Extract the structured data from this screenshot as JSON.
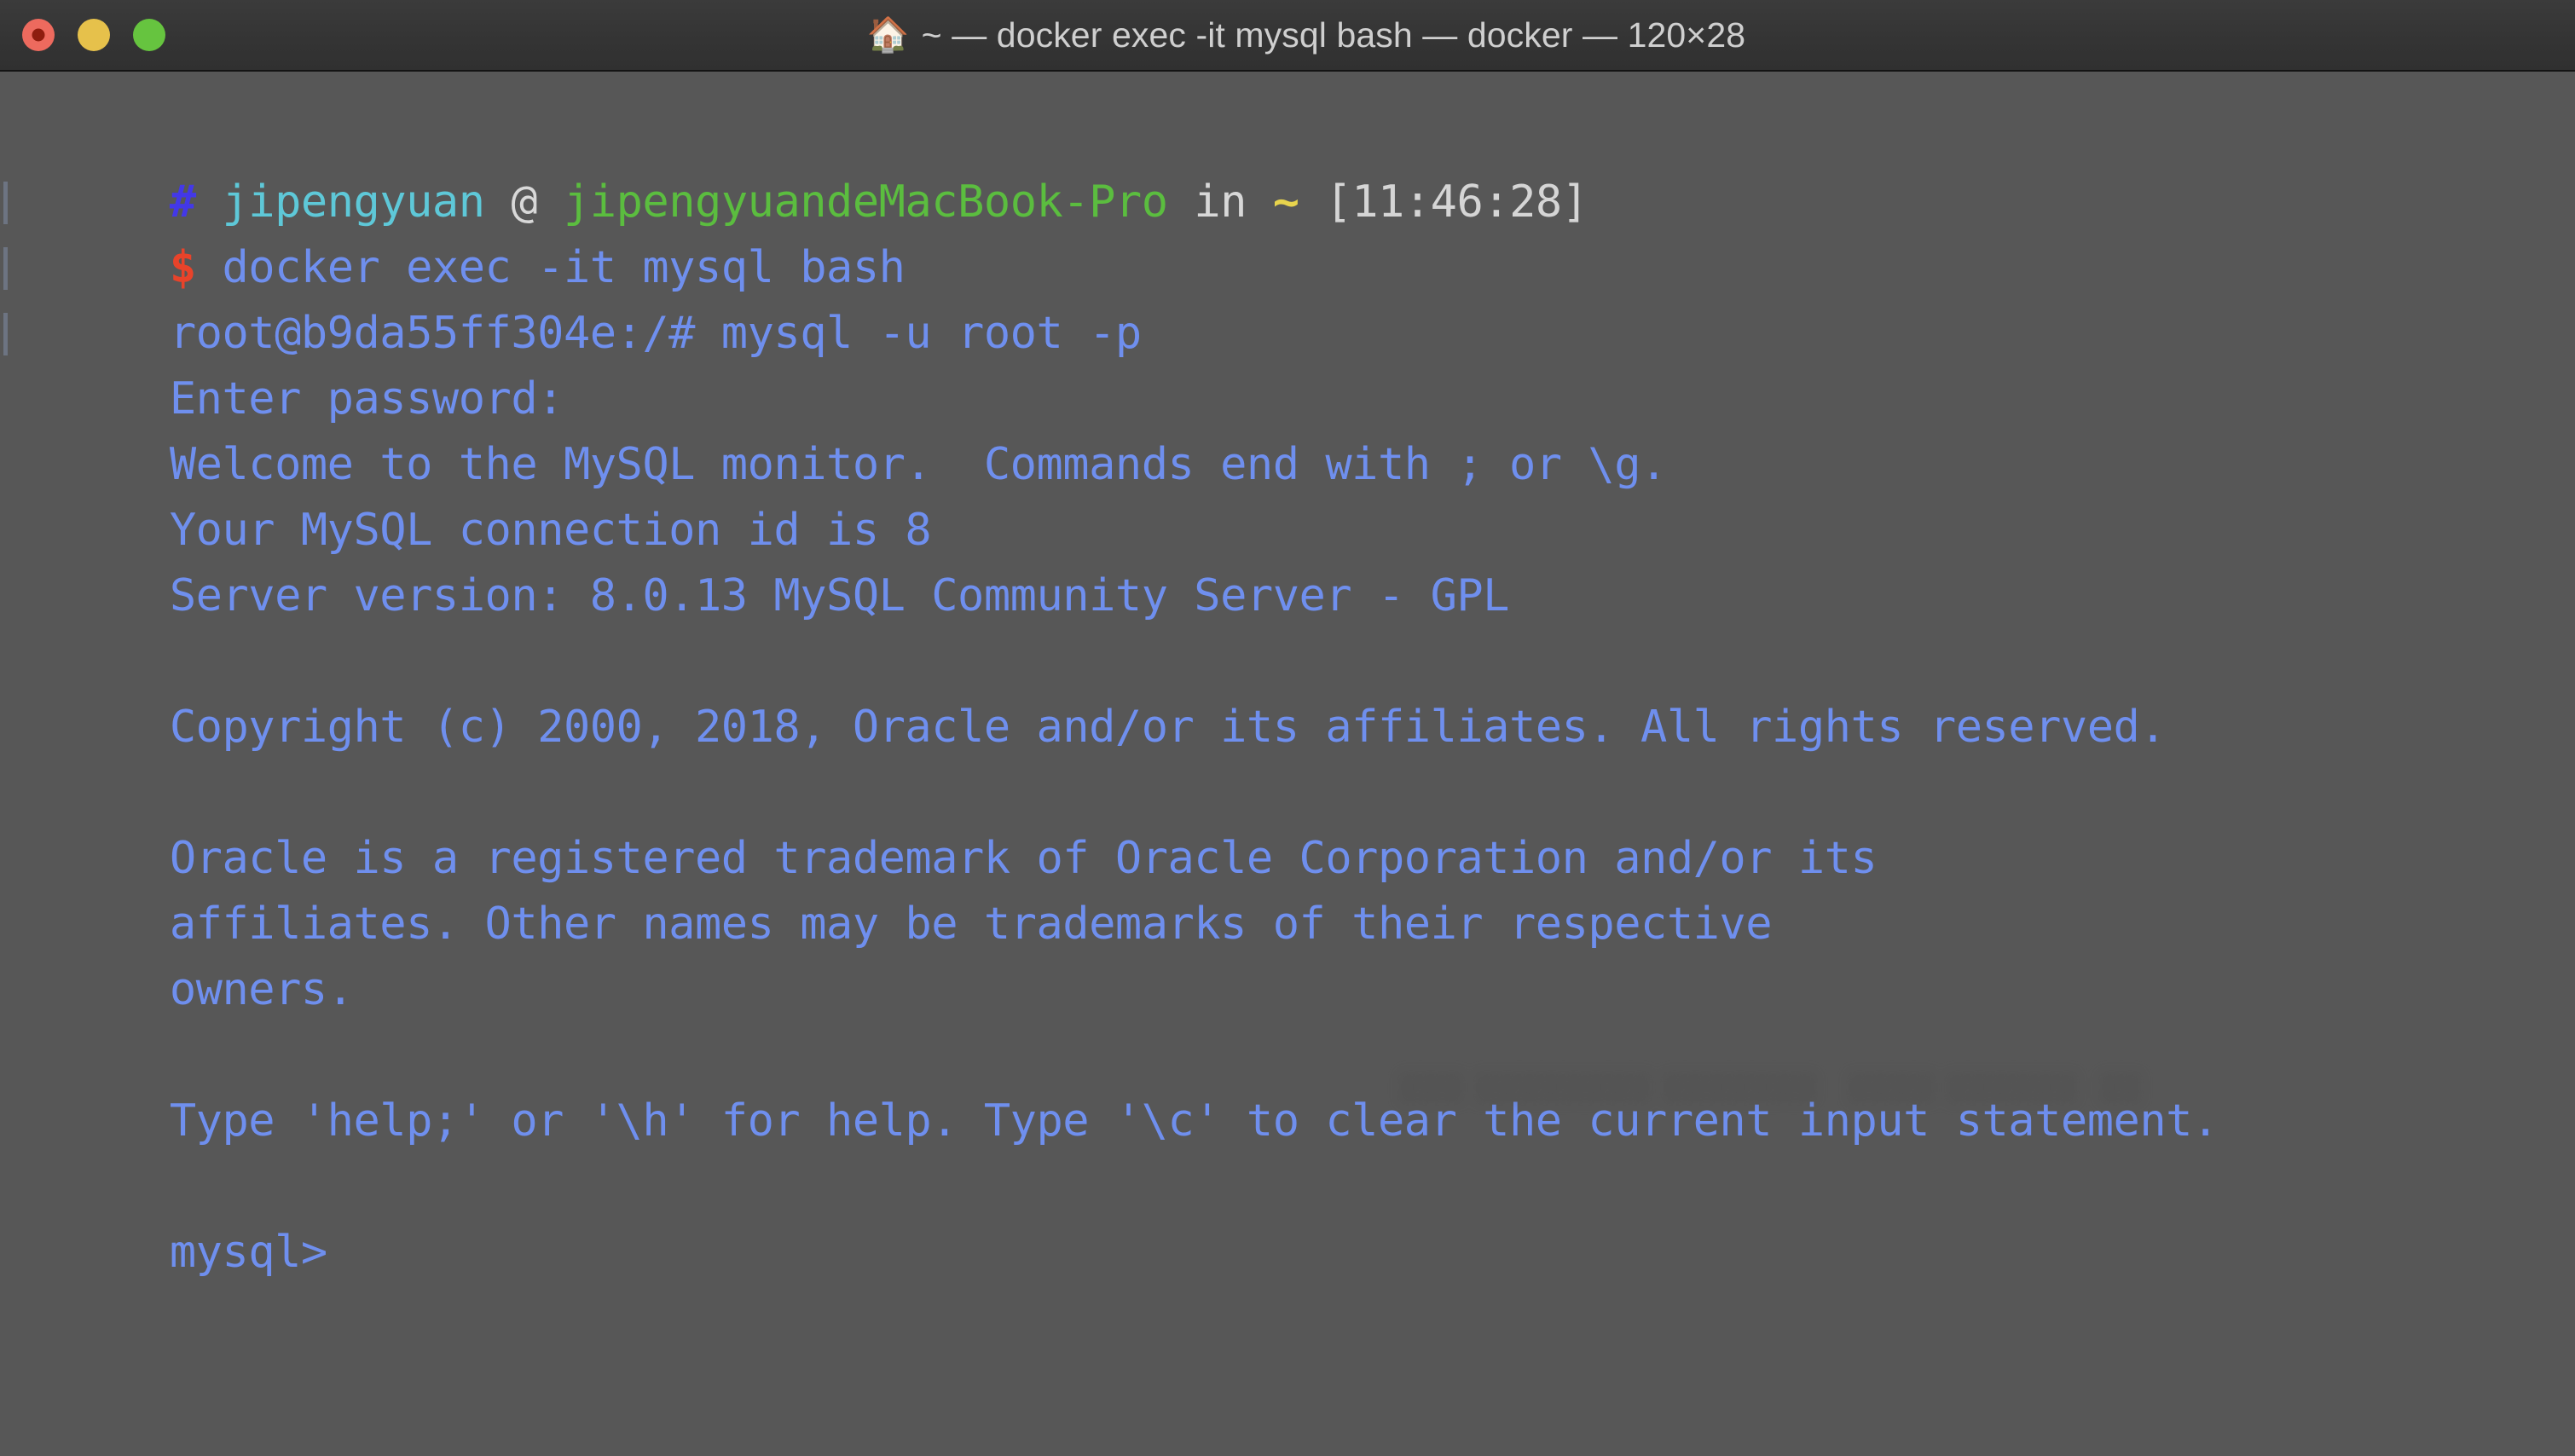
{
  "window": {
    "title": "~ — docker exec -it mysql bash — docker — 120×28",
    "home_icon": "🏠",
    "cols_rows": "120×28",
    "background_color": "#575757",
    "titlebar_color": "#353535",
    "traffic_lights": [
      {
        "name": "close",
        "color": "#ed6a5e"
      },
      {
        "name": "minimize",
        "color": "#e6c14b"
      },
      {
        "name": "maximize",
        "color": "#66c43f"
      }
    ]
  },
  "colors": {
    "prompt_hash": "#4338e8",
    "username": "#5ec8d8",
    "at_sign": "#d8d8d8",
    "hostname": "#5bbd3f",
    "tilde": "#e8d44d",
    "timestamp": "#d5d5d5",
    "dollar": "#e8432a",
    "command": "#6f8fee",
    "output": "#6f8fee"
  },
  "terminal": {
    "prompt": {
      "hash": "#",
      "user": "jipengyuan",
      "at": "@",
      "host": "jipengyuandeMacBook-Pro",
      "in": "in",
      "cwd": "~",
      "time": "[11:46:28]",
      "dollar": "$"
    },
    "command": "docker exec -it mysql bash",
    "lines": [
      {
        "id": "container-prompt",
        "text": "root@b9da55ff304e:/# mysql -u root -p",
        "edge": true
      },
      {
        "id": "password-prompt",
        "text": "Enter password:",
        "edge": true
      },
      {
        "id": "welcome",
        "text": "Welcome to the MySQL monitor.  Commands end with ; or \\g.",
        "edge": false
      },
      {
        "id": "connection-id",
        "text": "Your MySQL connection id is 8",
        "edge": false
      },
      {
        "id": "server-version",
        "text": "Server version: 8.0.13 MySQL Community Server - GPL",
        "edge": false
      },
      {
        "id": "blank-1",
        "text": "",
        "edge": false
      },
      {
        "id": "copyright",
        "text": "Copyright (c) 2000, 2018, Oracle and/or its affiliates. All rights reserved.",
        "edge": false
      },
      {
        "id": "blank-2",
        "text": "",
        "edge": false
      },
      {
        "id": "trademark-1",
        "text": "Oracle is a registered trademark of Oracle Corporation and/or its",
        "edge": false
      },
      {
        "id": "trademark-2",
        "text": "affiliates. Other names may be trademarks of their respective",
        "edge": false
      },
      {
        "id": "trademark-3",
        "text": "owners.",
        "edge": false
      },
      {
        "id": "blank-3",
        "text": "",
        "edge": false
      },
      {
        "id": "help-hint",
        "text": "Type 'help;' or '\\h' for help. Type '\\c' to clear the current input statement.",
        "edge": false
      },
      {
        "id": "blank-4",
        "text": "",
        "edge": false
      }
    ],
    "mysql_prompt": "mysql>",
    "watermark": "▒▒▒ ▒▒▒▒▒▒▒▒ ▒▒▒▒▒▒▒   ▒▒▒▒ ▒▒▒▒▒▒  ▒▒"
  }
}
